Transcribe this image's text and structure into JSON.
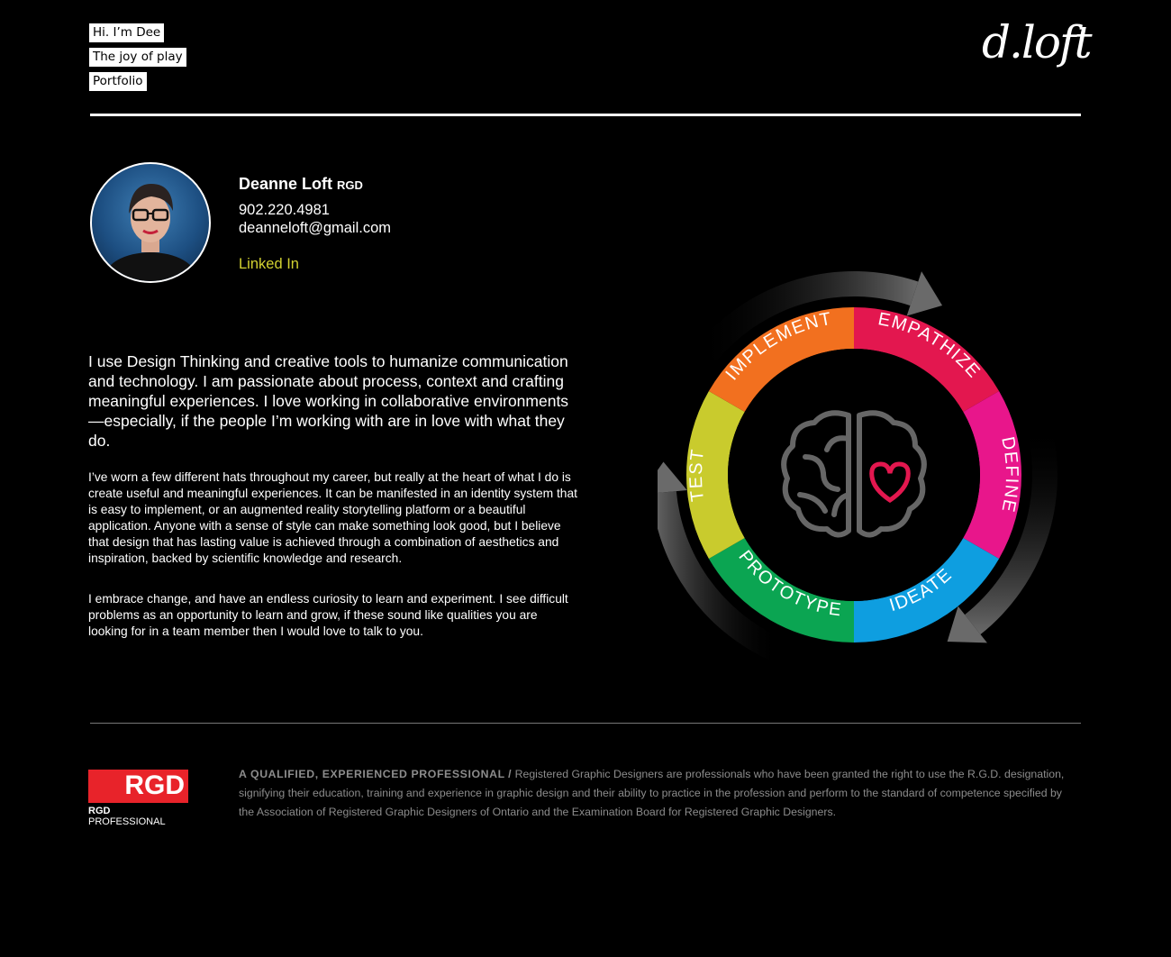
{
  "nav": {
    "items": [
      {
        "label": "Hi. I’m Dee"
      },
      {
        "label": "The joy of play"
      },
      {
        "label": "Portfolio"
      }
    ]
  },
  "logo": {
    "text": "d.loft"
  },
  "profile": {
    "name": "Deanne Loft",
    "designation": "RGD",
    "phone": "902.220.4981",
    "email": "deanneloft@gmail.com",
    "linkedin_label": "Linked In"
  },
  "content": {
    "lead": "I use Design Thinking and creative tools to humanize communication and technology. I am passionate about process, context and crafting meaningful experiences. I love working in collaborative environments—especially, if the people I’m working with are in love with what they do.",
    "paragraph1": "I’ve worn a few different hats throughout my career, but really at the heart of what I do is create useful and meaningful experiences. It can be manifested in an identity system that is easy to implement, or an augmented reality storytelling platform or a beautiful application. Anyone with a sense of style can make something look good, but I believe that design that has lasting value is achieved through a combination of aesthetics and inspiration, backed by scientific knowledge and research.",
    "paragraph2": "I embrace change, and have an endless curiosity to learn and experiment. I see difficult problems as an opportunity to learn and grow, if these sound like qualities you are looking for in a team member then I would love to talk to you."
  },
  "cycle": {
    "segments": [
      {
        "label": "EMPATHIZE",
        "color": "#e3174f"
      },
      {
        "label": "DEFINE",
        "color": "#e8168b"
      },
      {
        "label": "IDEATE",
        "color": "#0e9ee0"
      },
      {
        "label": "PROTOTYPE",
        "color": "#0ba552"
      },
      {
        "label": "TEST",
        "color": "#c9cb2d"
      },
      {
        "label": "IMPLEMENT",
        "color": "#f2701f"
      }
    ],
    "center_icon": "brain-heart-icon"
  },
  "footer": {
    "badge_text": "RGD",
    "badge_sub_bold": "RGD",
    "badge_sub": "PROFESSIONAL",
    "lead_in": "A QUALIFIED, EXPERIENCED PROFESSIONAL",
    "separator": "/",
    "text": "Registered Graphic Designers are professionals who have been granted the right to use the R.G.D. designation, signifying their education, training and experience in graphic design and their ability to practice in the profession and perform to the standard of competence specified by the Association of Registered Graphic Designers of Ontario and the Examination Board for Registered Graphic Designers."
  },
  "colors": {
    "background": "#000000",
    "accent_link": "#d2d131",
    "rgd_red": "#e8232a"
  }
}
